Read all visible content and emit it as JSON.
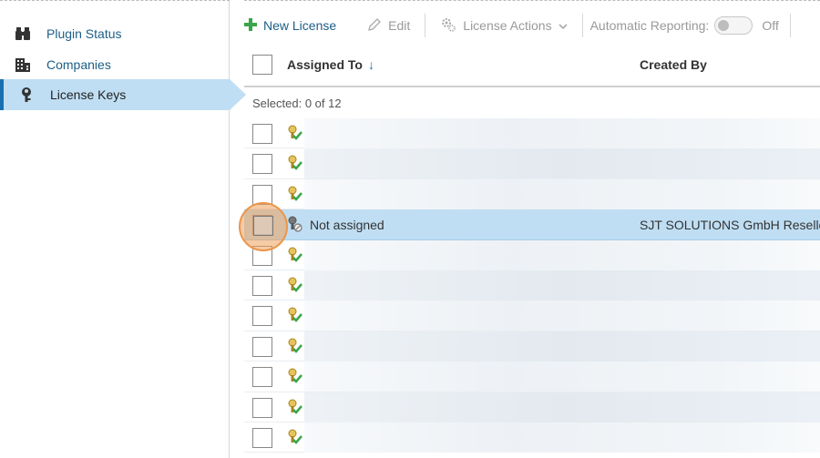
{
  "sidebar": {
    "items": [
      {
        "label": "Plugin Status",
        "icon": "binoculars-icon"
      },
      {
        "label": "Companies",
        "icon": "building-icon"
      },
      {
        "label": "License Keys",
        "icon": "key-icon"
      }
    ],
    "active": "License Keys"
  },
  "toolbar": {
    "new_license": "New License",
    "edit": "Edit",
    "license_actions": "License Actions",
    "automatic_reporting": "Automatic Reporting:",
    "reporting_state": "Off"
  },
  "grid": {
    "columns": {
      "assigned_to": "Assigned To",
      "created_by": "Created By"
    },
    "sort_arrow": "↓",
    "selected_text": "Selected: 0 of 12",
    "highlight_row": {
      "assigned_to": "Not assigned",
      "created_by": "SJT SOLUTIONS GmbH Reseller"
    }
  },
  "colors": {
    "accent": "#1a6fb0",
    "highlight": "#bfdef3",
    "link": "#1d5e86",
    "green": "#3aa54a"
  }
}
